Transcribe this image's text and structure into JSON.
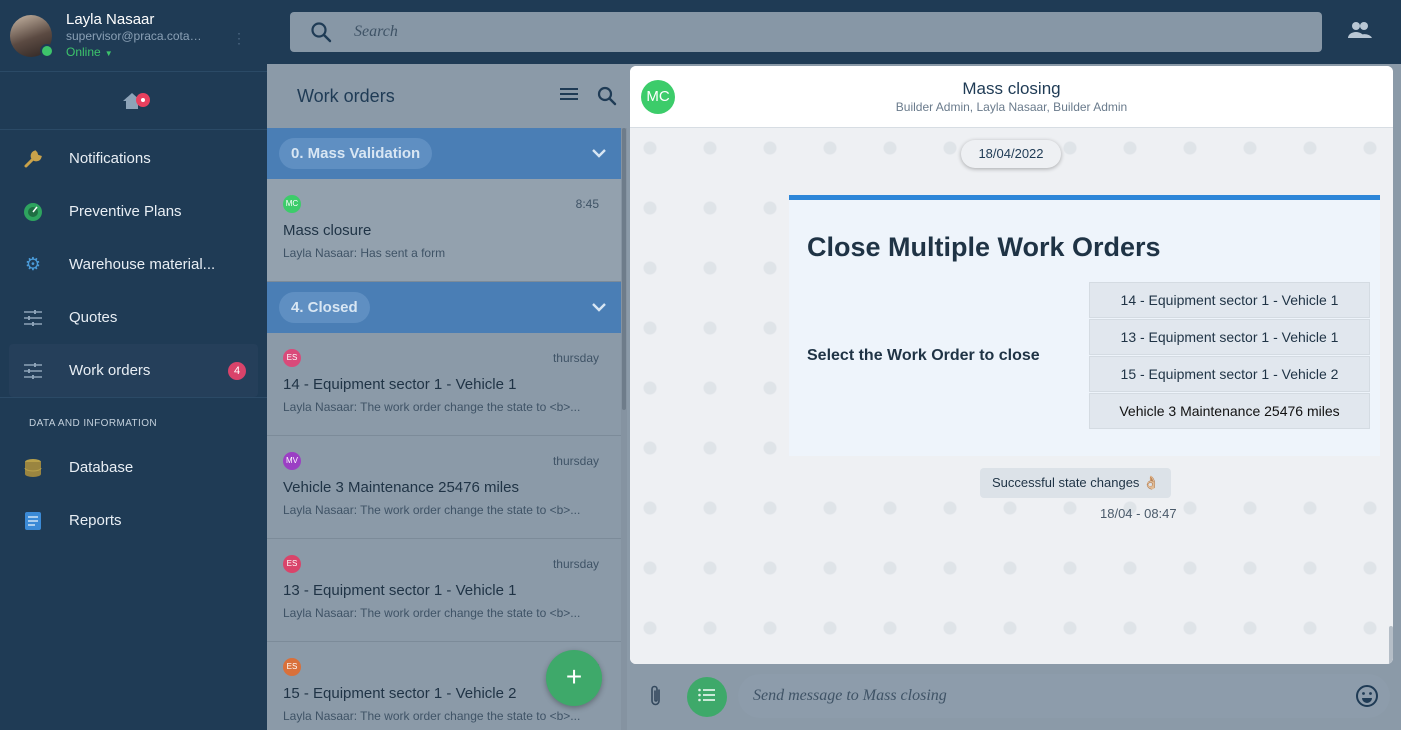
{
  "user": {
    "name": "Layla Nasaar",
    "email": "supervisor@praca.cotal...",
    "status": "Online"
  },
  "sidebar": {
    "items": [
      {
        "label": "Notifications",
        "icon": "wrench-icon"
      },
      {
        "label": "Preventive Plans",
        "icon": "gauge-icon"
      },
      {
        "label": "Warehouse material...",
        "icon": "gear-icon"
      },
      {
        "label": "Quotes",
        "icon": "sliders-icon"
      },
      {
        "label": "Work orders",
        "icon": "sliders-icon",
        "badge": "4"
      }
    ],
    "section_label": "DATA AND INFORMATION",
    "data_items": [
      {
        "label": "Database",
        "icon": "database-icon"
      },
      {
        "label": "Reports",
        "icon": "document-icon"
      }
    ]
  },
  "search": {
    "placeholder": "Search"
  },
  "work_orders": {
    "title": "Work orders",
    "groups": [
      {
        "label": "0. Mass Validation"
      },
      {
        "label": "4. Closed"
      }
    ],
    "items": [
      {
        "avatar": "MC",
        "color": "#3ccc6a",
        "time": "8:45",
        "title": "Mass closure",
        "sub": "Layla Nasaar: Has sent a form"
      },
      {
        "avatar": "ES",
        "color": "#d94a7a",
        "time": "thursday",
        "title": "14 - Equipment sector 1 - Vehicle 1",
        "sub": "Layla Nasaar: The work order change the state to <b>..."
      },
      {
        "avatar": "MV",
        "color": "#9b3fc4",
        "time": "thursday",
        "title": "Vehicle 3 Maintenance 25476 miles",
        "sub": "Layla Nasaar: The work order change the state to <b>..."
      },
      {
        "avatar": "ES",
        "color": "#d9446a",
        "time": "thursday",
        "title": "13 - Equipment sector 1 - Vehicle 1",
        "sub": "Layla Nasaar: The work order change the state to <b>..."
      },
      {
        "avatar": "ES",
        "color": "#d9703a",
        "time": "thursday",
        "title": "15 - Equipment sector 1 - Vehicle 2",
        "sub": "Layla Nasaar: The work order change the state to <b>..."
      }
    ]
  },
  "chat": {
    "avatar": "MC",
    "title": "Mass closing",
    "participants": "Builder Admin, Layla Nasaar, Builder Admin",
    "date": "18/04/2022",
    "form": {
      "title": "Close Multiple Work Orders",
      "label": "Select the Work Order to close",
      "options": [
        "14 - Equipment sector 1 - Vehicle 1",
        "13 - Equipment sector 1 - Vehicle 1",
        "15 - Equipment sector 1 - Vehicle 2",
        "Vehicle 3 Maintenance 25476 miles"
      ]
    },
    "status_message": "Successful state changes 👌🏼",
    "status_time": "18/04 - 08:47",
    "input_placeholder": "Send message to Mass closing"
  },
  "colors": {
    "sidebar": "#1f3b55",
    "accent_green": "#3ea96a",
    "group_blue": "#4a7eb5",
    "form_accent": "#2d86d8",
    "badge": "#d9436a"
  }
}
